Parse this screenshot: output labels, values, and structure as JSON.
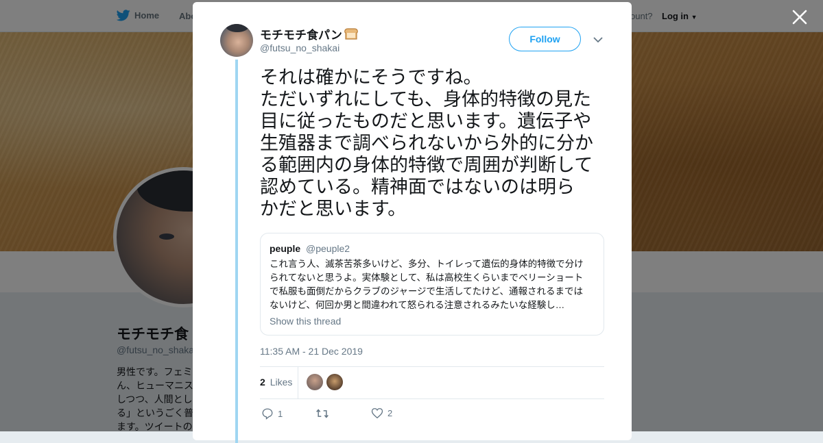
{
  "topbar": {
    "home_label": "Home",
    "about_label": "Abo",
    "account_text": "ccount?",
    "login_label": "Log in"
  },
  "background_profile": {
    "name": "モチモチ食",
    "handle": "@futsu_no_shaka",
    "bio_lines": [
      "男性です。フェミ",
      "ん、ヒューマニス",
      "しつつ、人間とし",
      "る」というごく普",
      "ます。ツイートの"
    ]
  },
  "tweet": {
    "author": {
      "display_name": "モチモチ食パン",
      "emoji_icon": "bread-icon",
      "handle": "@futsu_no_shakai"
    },
    "follow_label": "Follow",
    "text_lines": [
      "それは確かにそうですね。",
      "ただいずれにしても、身体的特徴の見た",
      "目に従ったものだと思います。遺伝子や",
      "生殖器まで調べられないから外的に分か",
      "る範囲内の身体的特徴で周囲が判断して",
      "認めている。精神面ではないのは明ら",
      "かだと思います。"
    ],
    "quoted": {
      "name": "peuple",
      "handle": "@peuple2",
      "text_lines": [
        "これ言う人、滅茶苦茶多いけど、多分、トイレって遺伝的身体的特徴で分け",
        "られてないと思うよ。実体験として、私は高校生くらいまでベリーショート",
        "で私服も面倒だからクラブのジャージで生活してたけど、通報されるまでは",
        "ないけど、何回か男と間違われて怒られる注意されるみたいな経験し…"
      ],
      "show_thread_label": "Show this thread"
    },
    "timestamp": "11:35 AM - 21 Dec 2019",
    "likes_count": "2",
    "likes_label": "Likes",
    "actions": {
      "reply_count": "1",
      "retweet_count": "",
      "like_count": "2"
    }
  },
  "colors": {
    "accent": "#1da1f2",
    "thread_line": "#9fd6f2",
    "text_secondary": "#657786"
  }
}
